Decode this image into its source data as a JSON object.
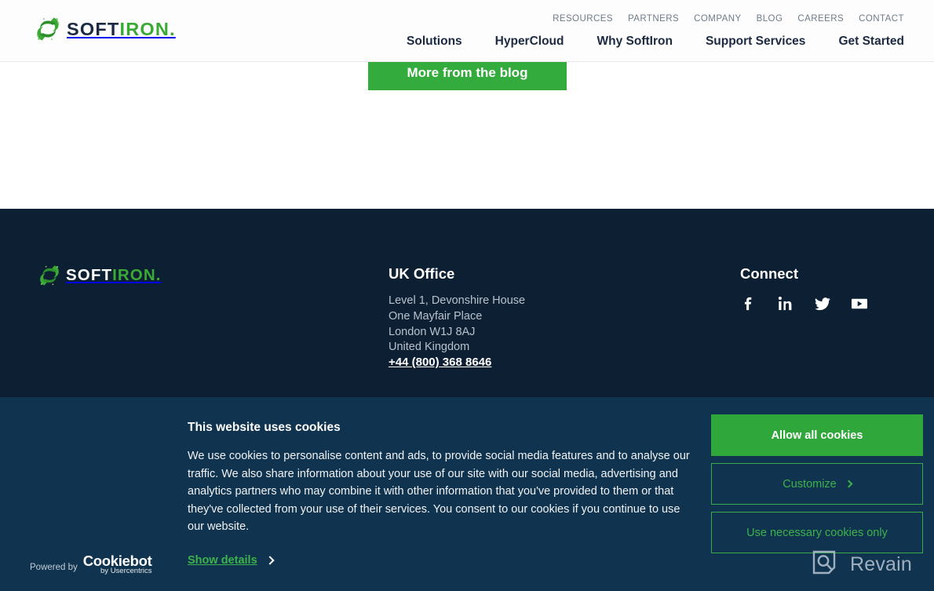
{
  "header": {
    "logo": {
      "icon": "softiron-recycle-s-icon",
      "part1": "SOFT",
      "part2": "IRON",
      "dot": "."
    },
    "utility_nav": [
      {
        "label": "RESOURCES"
      },
      {
        "label": "PARTNERS"
      },
      {
        "label": "COMPANY"
      },
      {
        "label": "BLOG"
      },
      {
        "label": "CAREERS"
      },
      {
        "label": "CONTACT"
      }
    ],
    "main_nav": [
      {
        "label": "Solutions"
      },
      {
        "label": "HyperCloud"
      },
      {
        "label": "Why SoftIron"
      },
      {
        "label": "Support Services"
      },
      {
        "label": "Get Started"
      }
    ]
  },
  "main": {
    "blog_cta_label": "More from the blog"
  },
  "footer": {
    "logo": {
      "icon": "softiron-recycle-s-icon",
      "part1": "SOFT",
      "part2": "IRON",
      "dot": "."
    },
    "office": {
      "title": "UK Office",
      "address_lines": [
        "Level 1, Devonshire House",
        "One Mayfair Place",
        "London W1J 8AJ",
        "United Kingdom"
      ],
      "phone": "+44 (800) 368 8646"
    },
    "connect": {
      "title": "Connect",
      "socials": [
        {
          "name": "facebook-icon",
          "label": "Facebook"
        },
        {
          "name": "linkedin-icon",
          "label": "LinkedIn"
        },
        {
          "name": "twitter-icon",
          "label": "Twitter"
        },
        {
          "name": "youtube-icon",
          "label": "YouTube"
        }
      ]
    }
  },
  "cookie_banner": {
    "title": "This website uses cookies",
    "text": "We use cookies to personalise content and ads, to provide social media features and to analyse our traffic. We also share information about your use of our site with our social media, advertising and analytics partners who may combine it with other information that you've provided to them or that they've collected from your use of their services. You consent to our cookies if you continue to use our website.",
    "buttons": {
      "allow_all": "Allow all cookies",
      "customize": "Customize",
      "necessary_only": "Use necessary cookies only"
    },
    "show_details": "Show details",
    "powered_by_label": "Powered by",
    "powered_by_name": "Cookiebot",
    "powered_by_sub": "by Usercentrics"
  },
  "watermark": {
    "text": "Revain",
    "icon": "revain-magnifier-icon"
  },
  "colors": {
    "brand_green": "#33ab3d",
    "cta_green": "#2fa73b",
    "footer_navy": "#0d1f33",
    "banner_navy": "#10344f",
    "nav_dark": "#1b2a42",
    "muted_text": "#6e7b8c"
  }
}
